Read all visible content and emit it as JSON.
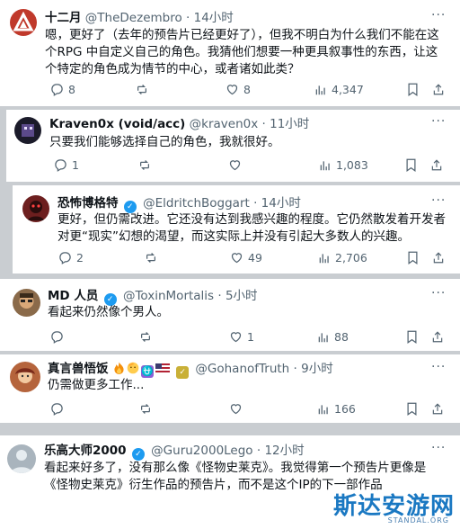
{
  "tweets": [
    {
      "display_name": "十二月",
      "handle": "@TheDezembro",
      "time": "· 14小时",
      "text": "嗯，更好了（去年的预告片已经更好了），但我不明白为什么我们不能在这个RPG 中自定义自己的角色。我猜他们想要一种更具叙事性的东西，让这个特定的角色成为情节的中心，或者诸如此类？",
      "replies": "8",
      "reposts": "",
      "likes": "8",
      "views": "4,347",
      "avatar_color": "#c0392b"
    },
    {
      "display_name": "Kraven0x (void/acc)",
      "handle": "@kraven0x",
      "time": "· 11小时",
      "text": "只要我们能够选择自己的角色，我就很好。",
      "replies": "1",
      "reposts": "",
      "likes": "",
      "views": "1,083",
      "avatar_color": "#1b1b2a"
    },
    {
      "display_name": "恐怖博格特",
      "handle": "@EldritchBoggart",
      "time": "· 14小时",
      "text": "更好，但仍需改进。它还没有达到我感兴趣的程度。它仍然散发着开发者对更“现实”幻想的渴望，而这实际上并没有引起大多数人的兴趣。",
      "replies": "2",
      "reposts": "",
      "likes": "49",
      "views": "2,706",
      "avatar_color": "#6d1f1f"
    },
    {
      "display_name": "MD 人员",
      "handle": "@ToxinMortalis",
      "time": "· 5小时",
      "text": "看起来仍然像个男人。",
      "replies": "",
      "reposts": "",
      "likes": "1",
      "views": "88",
      "avatar_color": "#8a6a4a"
    },
    {
      "display_name": "真言兽悟饭",
      "handle": "@GohanofTruth",
      "time": "· 9小时",
      "text": "仍需做更多工作...",
      "replies": "",
      "reposts": "",
      "likes": "",
      "views": "166",
      "avatar_color": "#b5643c"
    },
    {
      "display_name": "乐高大师2000",
      "handle": "@Guru2000Lego",
      "time": "· 12小时",
      "text": "看起来好多了，没有那么像《怪物史莱克》。我觉得第一个预告片更像是《怪物史莱克》衍生作品的预告片，而不是这个IP的下一部作品",
      "avatar_color": "#a9b4bd"
    }
  ],
  "watermark": {
    "cn": "斯达安游网",
    "en": "STANDAL.ORG"
  }
}
